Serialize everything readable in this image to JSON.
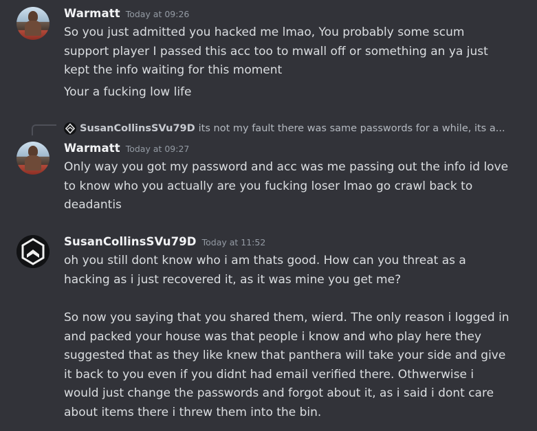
{
  "messages": [
    {
      "username": "Warmatt",
      "timestamp": "Today at 09:26",
      "lines": [
        "So you just admitted you hacked me lmao, You probably some scum support player I passed this acc too to mwall off or something an ya just kept the info waiting for this moment",
        "Your a fucking low life"
      ]
    },
    {
      "reply": {
        "username": "SusanCollinsSVu79D",
        "text": "its not my fault there was same passwords for a while, its a..."
      },
      "username": "Warmatt",
      "timestamp": "Today at 09:27",
      "lines": [
        "Only way you got my password and acc was me passing out the info id love to know who you actually are you fucking loser lmao go crawl back to deadantis"
      ]
    },
    {
      "username": "SusanCollinsSVu79D",
      "timestamp": "Today at 11:52",
      "lines": [
        "oh you still dont know who i am thats good. How can you threat as a hacking as i just recovered it, as it was mine you get me?",
        "So now you saying that you shared them, wierd. The only reason i logged in and packed your house was that people i know and who play here they suggested that as they like knew that panthera will take your side and give it back to you even if you didnt had email verified there. Othwerwise i would just change the passwords and forgot about it, as i said i dont care about items there i threw them into the bin."
      ]
    }
  ],
  "colors": {
    "background": "#323339",
    "username": "#f2f3f5",
    "timestamp": "#949ba4",
    "text": "#dbdee1"
  }
}
